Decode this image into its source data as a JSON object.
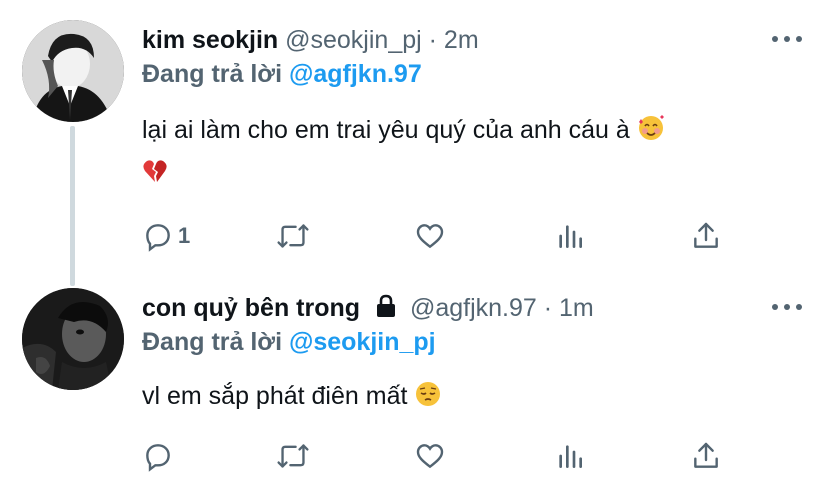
{
  "tweets": [
    {
      "name": "kim seokjin",
      "handle": "@seokjin_pj",
      "sep": "·",
      "time": "2m",
      "replying_prefix": "Đang trả lời",
      "replying_to": "@agfjkn.97",
      "text_line1": "lại ai làm cho em trai yêu quý của anh cáu à",
      "emoji1": "smiling-face-with-hearts",
      "emoji2": "broken-heart",
      "reply_count": "1"
    },
    {
      "name": "con quỷ bên trong",
      "handle": "@agfjkn.97",
      "sep": "·",
      "time": "1m",
      "replying_prefix": "Đang trả lời",
      "replying_to": "@seokjin_pj",
      "text_line1": "vl em sắp phát điên mất",
      "emoji1": "pensive-face",
      "reply_count": ""
    }
  ],
  "colors": {
    "text": "#0f1419",
    "secondary": "#536471",
    "link": "#1d9bf0",
    "thread_line": "#cfd9de"
  },
  "icons": [
    "reply-icon",
    "retweet-icon",
    "like-icon",
    "analytics-icon",
    "share-icon",
    "more-icon",
    "lock-icon"
  ]
}
